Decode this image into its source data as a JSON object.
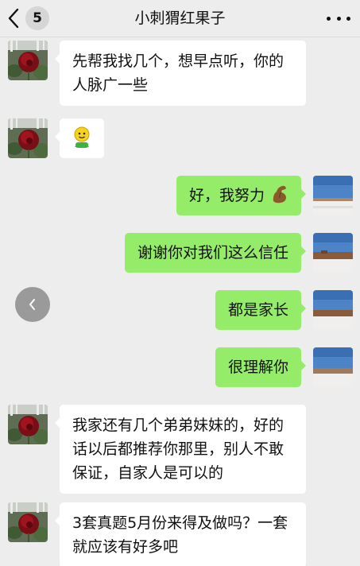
{
  "header": {
    "back_count": "5",
    "title": "小刺猬红果子"
  },
  "messages": [
    {
      "side": "left",
      "text": "先帮我找几个，想早点听，你的人脉广一些"
    },
    {
      "side": "left",
      "sticker": "smiling-cartoon-emoji"
    },
    {
      "side": "right",
      "text": "好，我努力",
      "emoji": "flexed-biceps"
    },
    {
      "side": "right",
      "text": "谢谢你对我们这么信任"
    },
    {
      "side": "right",
      "text": "都是家长"
    },
    {
      "side": "right",
      "text": "很理解你"
    },
    {
      "side": "left",
      "text": "我家还有几个弟弟妹妹的，好的话以后都推荐你那里，别人不敢保证，自家人是可以的"
    },
    {
      "side": "left",
      "text": "3套真题5月份来得及做吗？一套就应该有好多吧"
    }
  ],
  "colors": {
    "background": "#ededed",
    "outgoing_bubble": "#95ec69",
    "incoming_bubble": "#ffffff"
  }
}
